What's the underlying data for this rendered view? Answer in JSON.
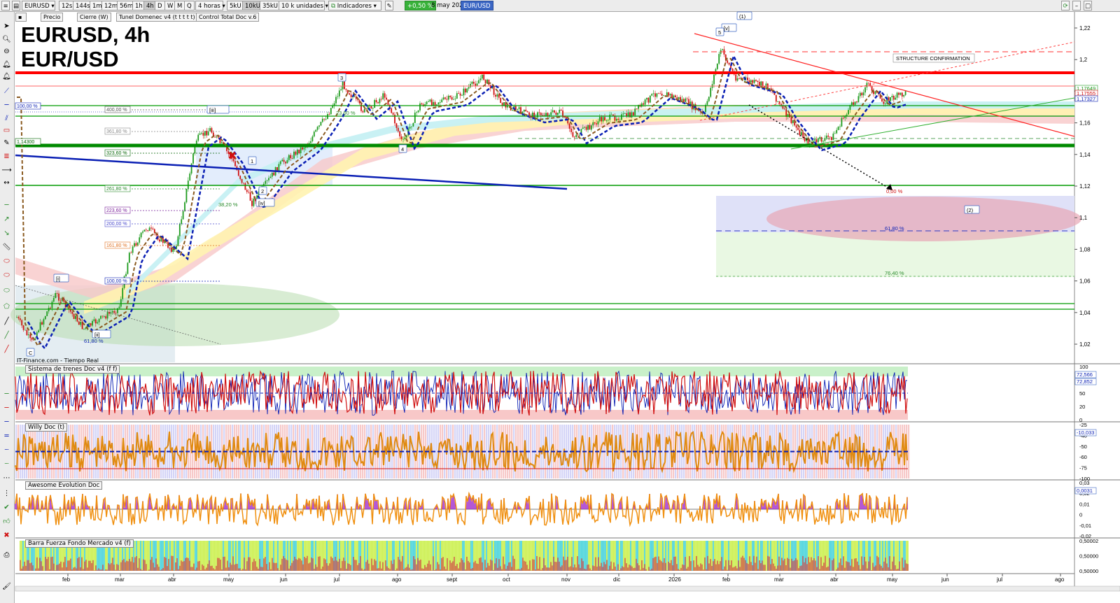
{
  "toolbar": {
    "symbol": "EURUSD",
    "timeframes": [
      "12s",
      "144s",
      "1m",
      "12m",
      "56m",
      "1h",
      "4h",
      "D",
      "W",
      "M",
      "Q"
    ],
    "selected_timeframe": "4h",
    "period": "4 horas",
    "volume_units": [
      "5kU",
      "10kU",
      "35kU"
    ],
    "selected_volume": "10kU",
    "units": "10 k unidades",
    "indicators_label": "Indicadores",
    "change": "+0,50 %",
    "date": "8 may 2026",
    "pair_badge": "EUR/USD"
  },
  "overlay_indicators": [
    "Precio",
    "Cierre (W)",
    "Tunel Domenec v4 (t t t t t)",
    "Control Total Doc v.6"
  ],
  "title": {
    "line1": "EURUSD, 4h",
    "line2": "EUR/USD"
  },
  "feed_label": "IT-Finance.com - Tiempo Real",
  "price_axis": {
    "ticks": [
      "1,22",
      "1,2",
      "1,18",
      "1,16",
      "1,14",
      "1,12",
      "1,1",
      "1,08",
      "1,06",
      "1,04",
      "1,02"
    ],
    "labels": [
      "1,17649",
      "1,17555",
      "1,17327"
    ]
  },
  "time_axis": [
    "feb",
    "mar",
    "abr",
    "may",
    "jun",
    "jul",
    "ago",
    "sept",
    "oct",
    "nov",
    "dic",
    "2026",
    "feb",
    "mar",
    "abr",
    "may",
    "jun",
    "jul",
    "ago"
  ],
  "annotations": {
    "left_levels": [
      "100,00 %",
      "400,00 %",
      "361,80 %",
      "1,14300",
      "323,60 %",
      "261,80 %",
      "223,60 %",
      "200,00 %",
      "161,80 %",
      "100,00 %"
    ],
    "fib_labels": [
      "38,20 %",
      "61,80 %",
      "61,80 %",
      "76,40 %",
      "0,00 %",
      "23,60 %"
    ],
    "waves": [
      "(1)",
      "[v]",
      "5",
      "3",
      "[iii]",
      "1",
      "2",
      "[iv]",
      "4",
      "[i]",
      "[ii]",
      "C",
      "(2)"
    ],
    "structure": "STRUCTURE CONFIRMATION"
  },
  "panels": [
    {
      "title": "Sistema de trenes Doc v4 (f f)",
      "ticks": [
        "100",
        "80",
        "50",
        "20",
        "0"
      ],
      "values": [
        "72,566",
        "72,852"
      ]
    },
    {
      "title": "Willy Doc (t)",
      "ticks": [
        "-25",
        "-40",
        "-50",
        "-60",
        "-75",
        "-100"
      ],
      "values": [
        "-10,033"
      ]
    },
    {
      "title": "Awesome Evolution Doc",
      "ticks": [
        "0,03",
        "0,02",
        "0,01",
        "0",
        "-0,01",
        "-0,02"
      ],
      "values": [
        "0,0031"
      ]
    },
    {
      "title": "Barra Fuerza Fondo Mercado v4 (f)",
      "ticks": [
        "0,50002",
        "0,50000",
        "0,50000"
      ],
      "values": []
    }
  ],
  "colors": {
    "up": "#1e9b1e",
    "down": "#d01010",
    "resistance": "#ff0000",
    "support": "#009a00",
    "trend": "#0a1fb4"
  }
}
